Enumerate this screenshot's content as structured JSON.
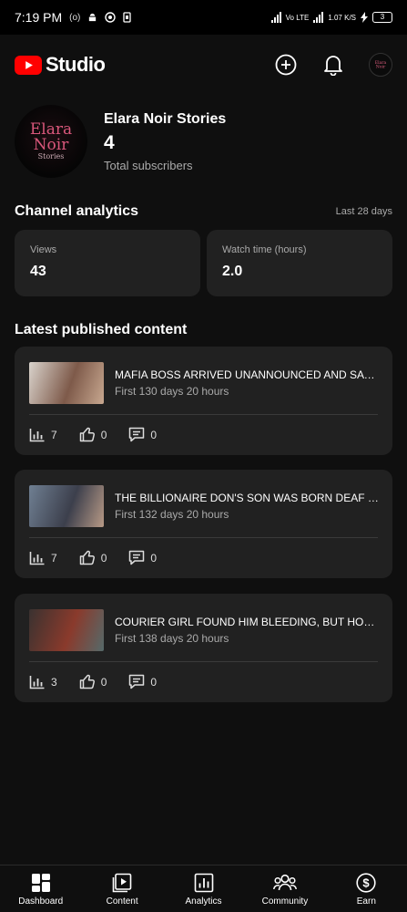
{
  "status_bar": {
    "time": "7:19 PM",
    "mini_icons": "(o)",
    "network": "Vo LTE",
    "speed": "1.07 K/S",
    "battery": "3"
  },
  "header": {
    "app_name": "Studio"
  },
  "channel": {
    "avatar_text": [
      "Elara",
      "Noir",
      "Stories"
    ],
    "name": "Elara Noir Stories",
    "subscriber_count": "4",
    "subscriber_label": "Total subscribers"
  },
  "analytics": {
    "title": "Channel analytics",
    "range": "Last 28 days",
    "metrics": [
      {
        "label": "Views",
        "value": "43"
      },
      {
        "label": "Watch time (hours)",
        "value": "2.0"
      }
    ]
  },
  "latest": {
    "title": "Latest published content",
    "items": [
      {
        "title": "MAFIA BOSS ARRIVED UNANNOUNCED AND SAW THE NANNY...",
        "subtitle": "First 130 days 20 hours",
        "views": "7",
        "likes": "0",
        "comments": "0",
        "thumb_colors": [
          "#d9d3cc",
          "#7e5a4a",
          "#c8a890"
        ]
      },
      {
        "title": "THE BILLIONAIRE DON'S SON WAS BORN DEAF — THE NEW...",
        "subtitle": "First 132 days 20 hours",
        "views": "7",
        "likes": "0",
        "comments": "0",
        "thumb_colors": [
          "#6f7f92",
          "#3c3f4c",
          "#b89a86"
        ]
      },
      {
        "title": "COURIER GIRL FOUND HIM BLEEDING, BUT HOLDING...",
        "subtitle": "First 138 days 20 hours",
        "views": "3",
        "likes": "0",
        "comments": "0",
        "thumb_colors": [
          "#3a3230",
          "#8a3a2c",
          "#556a6a"
        ]
      }
    ]
  },
  "bottom_nav": [
    {
      "label": "Dashboard",
      "icon": "dashboard-icon"
    },
    {
      "label": "Content",
      "icon": "content-icon"
    },
    {
      "label": "Analytics",
      "icon": "analytics-icon"
    },
    {
      "label": "Community",
      "icon": "community-icon"
    },
    {
      "label": "Earn",
      "icon": "earn-icon"
    }
  ]
}
